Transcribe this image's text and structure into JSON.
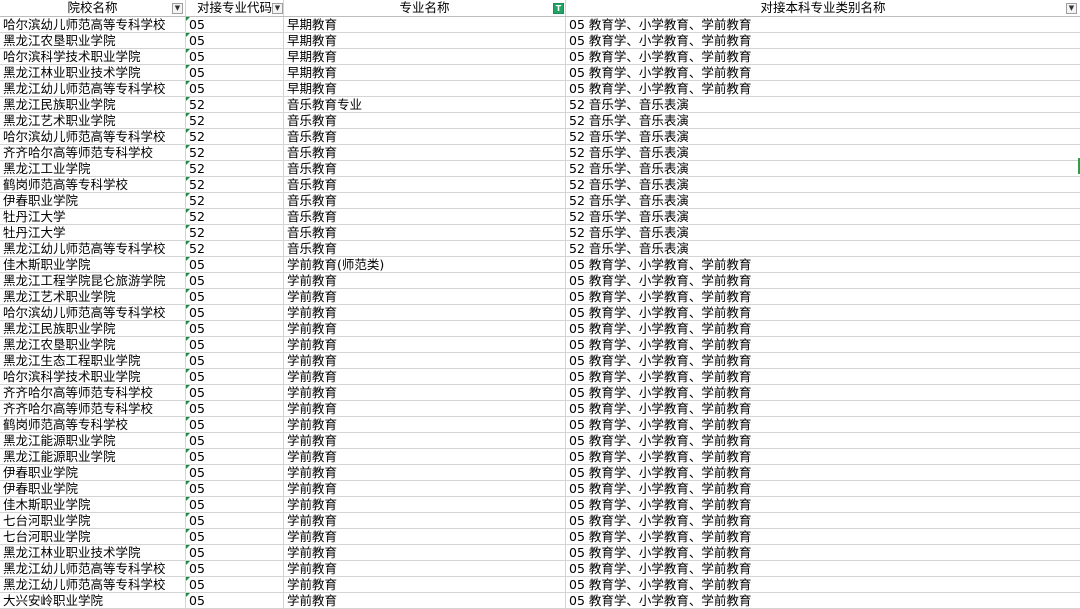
{
  "header": {
    "school": "院校名称",
    "code": "对接专业代码",
    "major": "专业名称",
    "category": "对接本科专业类别名称",
    "text_filter_glyph": "T",
    "filter_glyph": "▼"
  },
  "rows": [
    [
      "哈尔滨幼儿师范高等专科学校",
      "05",
      "早期教育",
      "05 教育学、小学教育、学前教育"
    ],
    [
      "黑龙江农垦职业学院",
      "05",
      "早期教育",
      "05 教育学、小学教育、学前教育"
    ],
    [
      "哈尔滨科学技术职业学院",
      "05",
      "早期教育",
      "05 教育学、小学教育、学前教育"
    ],
    [
      "黑龙江林业职业技术学院",
      "05",
      "早期教育",
      "05 教育学、小学教育、学前教育"
    ],
    [
      "黑龙江幼儿师范高等专科学校",
      "05",
      "早期教育",
      "05 教育学、小学教育、学前教育"
    ],
    [
      "黑龙江民族职业学院",
      "52",
      "音乐教育专业",
      "52 音乐学、音乐表演"
    ],
    [
      "黑龙江艺术职业学院",
      "52",
      "音乐教育",
      "52 音乐学、音乐表演"
    ],
    [
      "哈尔滨幼儿师范高等专科学校",
      "52",
      "音乐教育",
      "52 音乐学、音乐表演"
    ],
    [
      "齐齐哈尔高等师范专科学校",
      "52",
      "音乐教育",
      "52 音乐学、音乐表演"
    ],
    [
      "黑龙江工业学院",
      "52",
      "音乐教育",
      "52 音乐学、音乐表演"
    ],
    [
      "鹤岗师范高等专科学校",
      "52",
      "音乐教育",
      "52 音乐学、音乐表演"
    ],
    [
      "伊春职业学院",
      "52",
      "音乐教育",
      "52 音乐学、音乐表演"
    ],
    [
      "牡丹江大学",
      "52",
      "音乐教育",
      "52 音乐学、音乐表演"
    ],
    [
      "牡丹江大学",
      "52",
      "音乐教育",
      "52 音乐学、音乐表演"
    ],
    [
      "黑龙江幼儿师范高等专科学校",
      "52",
      "音乐教育",
      "52 音乐学、音乐表演"
    ],
    [
      "佳木斯职业学院",
      "05",
      "学前教育(师范类)",
      "05 教育学、小学教育、学前教育"
    ],
    [
      "黑龙江工程学院昆仑旅游学院",
      "05",
      "学前教育",
      "05 教育学、小学教育、学前教育"
    ],
    [
      "黑龙江艺术职业学院",
      "05",
      "学前教育",
      "05 教育学、小学教育、学前教育"
    ],
    [
      "哈尔滨幼儿师范高等专科学校",
      "05",
      "学前教育",
      "05 教育学、小学教育、学前教育"
    ],
    [
      "黑龙江民族职业学院",
      "05",
      "学前教育",
      "05 教育学、小学教育、学前教育"
    ],
    [
      "黑龙江农垦职业学院",
      "05",
      "学前教育",
      "05 教育学、小学教育、学前教育"
    ],
    [
      "黑龙江生态工程职业学院",
      "05",
      "学前教育",
      "05 教育学、小学教育、学前教育"
    ],
    [
      "哈尔滨科学技术职业学院",
      "05",
      "学前教育",
      "05 教育学、小学教育、学前教育"
    ],
    [
      "齐齐哈尔高等师范专科学校",
      "05",
      "学前教育",
      "05 教育学、小学教育、学前教育"
    ],
    [
      "齐齐哈尔高等师范专科学校",
      "05",
      "学前教育",
      "05 教育学、小学教育、学前教育"
    ],
    [
      "鹤岗师范高等专科学校",
      "05",
      "学前教育",
      "05 教育学、小学教育、学前教育"
    ],
    [
      "黑龙江能源职业学院",
      "05",
      "学前教育",
      "05 教育学、小学教育、学前教育"
    ],
    [
      "黑龙江能源职业学院",
      "05",
      "学前教育",
      "05 教育学、小学教育、学前教育"
    ],
    [
      "伊春职业学院",
      "05",
      "学前教育",
      "05 教育学、小学教育、学前教育"
    ],
    [
      "伊春职业学院",
      "05",
      "学前教育",
      "05 教育学、小学教育、学前教育"
    ],
    [
      "佳木斯职业学院",
      "05",
      "学前教育",
      "05 教育学、小学教育、学前教育"
    ],
    [
      "七台河职业学院",
      "05",
      "学前教育",
      "05 教育学、小学教育、学前教育"
    ],
    [
      "七台河职业学院",
      "05",
      "学前教育",
      "05 教育学、小学教育、学前教育"
    ],
    [
      "黑龙江林业职业技术学院",
      "05",
      "学前教育",
      "05 教育学、小学教育、学前教育"
    ],
    [
      "黑龙江幼儿师范高等专科学校",
      "05",
      "学前教育",
      "05 教育学、小学教育、学前教育"
    ],
    [
      "黑龙江幼儿师范高等专科学校",
      "05",
      "学前教育",
      "05 教育学、小学教育、学前教育"
    ],
    [
      "大兴安岭职业学院",
      "05",
      "学前教育",
      "05 教育学、小学教育、学前教育"
    ]
  ]
}
